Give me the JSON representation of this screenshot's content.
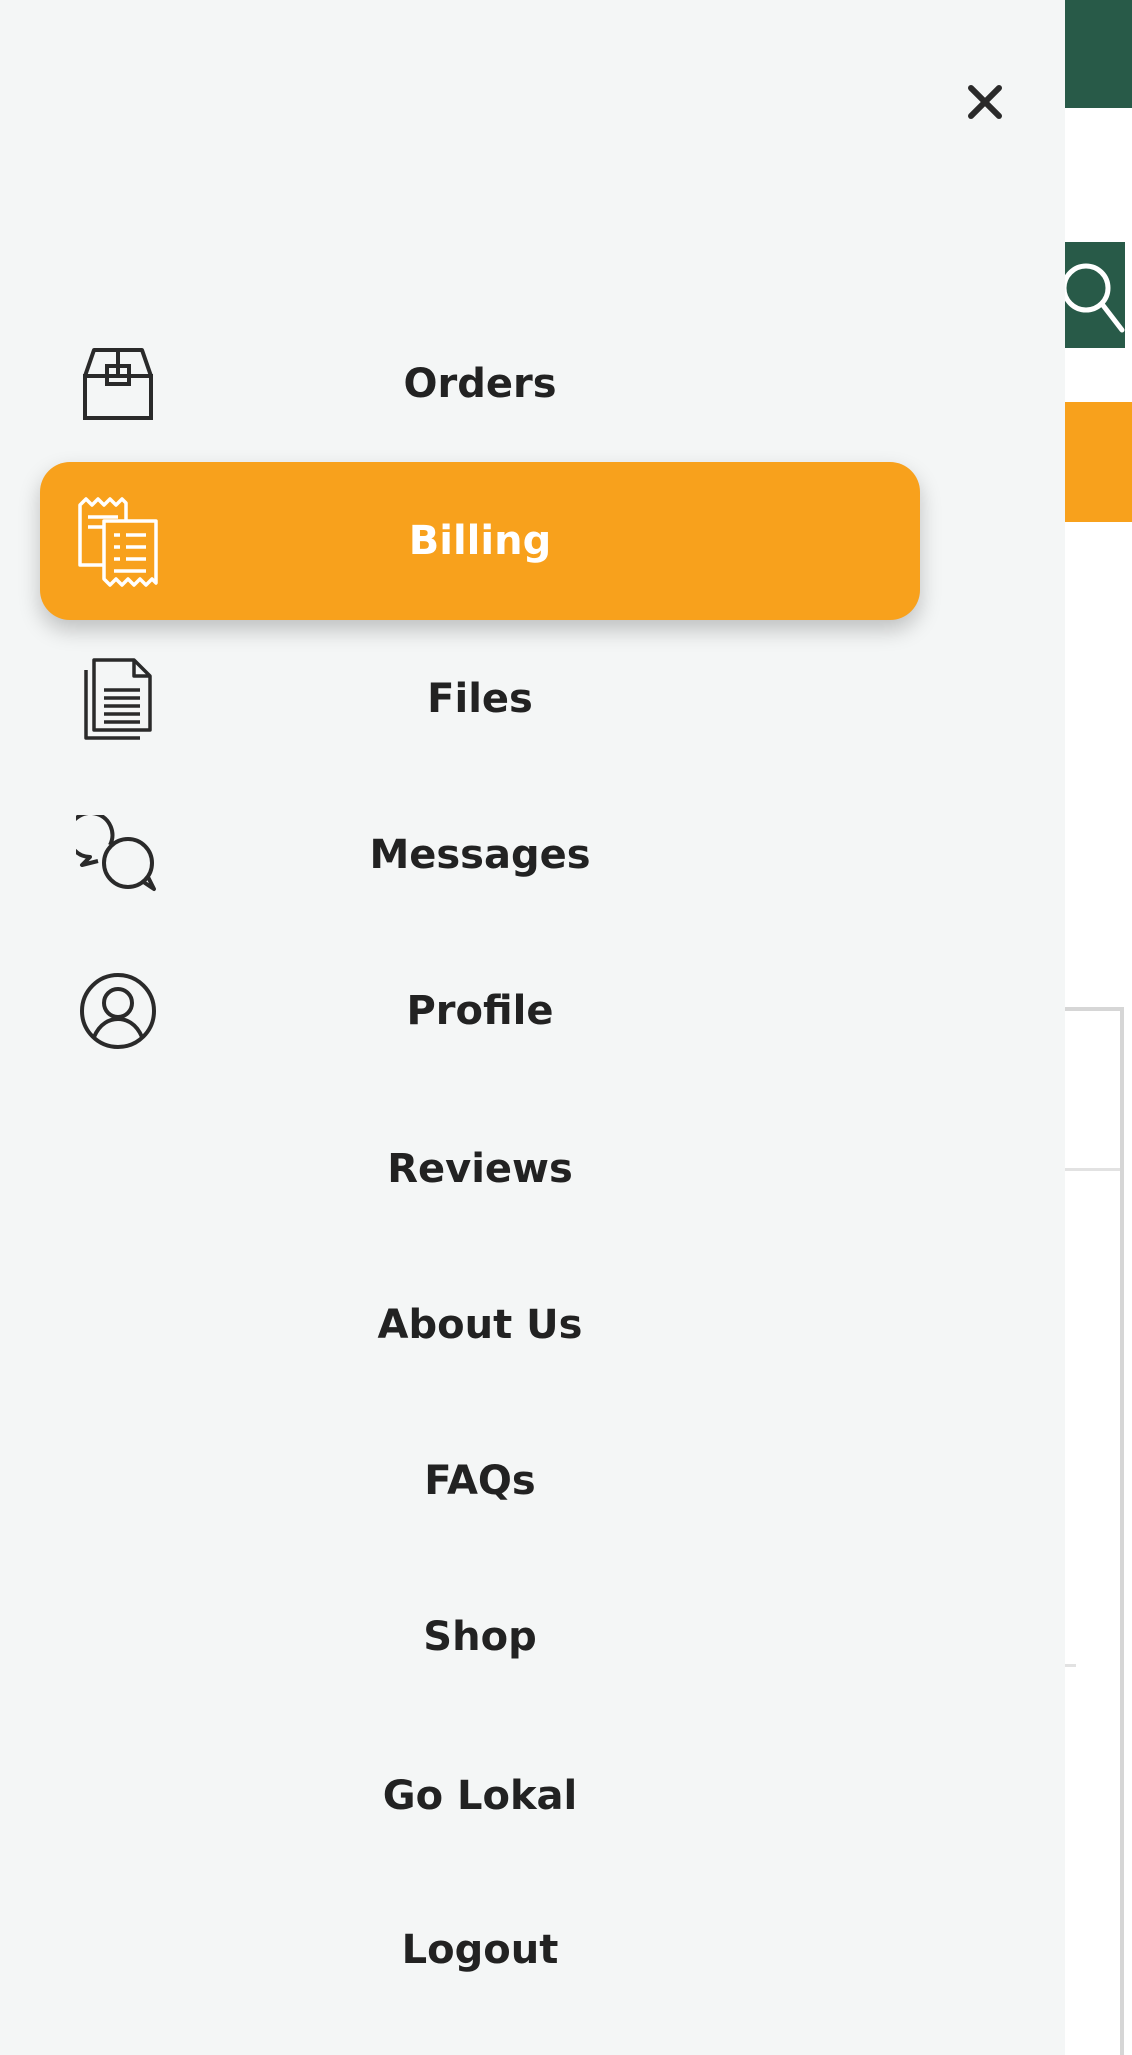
{
  "colors": {
    "accent": "#F8A11C",
    "brand_green": "#285A48",
    "drawer_bg": "#F4F6F6",
    "text": "#222222"
  },
  "drawer": {
    "close_icon": "close-icon",
    "items": [
      {
        "label": "Orders",
        "icon": "box-icon",
        "active": false
      },
      {
        "label": "Billing",
        "icon": "receipt-icon",
        "active": true
      },
      {
        "label": "Files",
        "icon": "document-icon",
        "active": false
      },
      {
        "label": "Messages",
        "icon": "chat-bubbles-icon",
        "active": false
      },
      {
        "label": "Profile",
        "icon": "user-circle-icon",
        "active": false
      },
      {
        "label": "Reviews",
        "icon": "",
        "active": false
      },
      {
        "label": "About Us",
        "icon": "",
        "active": false
      },
      {
        "label": "FAQs",
        "icon": "",
        "active": false
      },
      {
        "label": "Shop",
        "icon": "",
        "active": false
      },
      {
        "label": "Go Lokal",
        "icon": "",
        "active": false
      },
      {
        "label": "Logout",
        "icon": "",
        "active": false
      }
    ]
  },
  "background": {
    "search_icon": "search-icon"
  }
}
